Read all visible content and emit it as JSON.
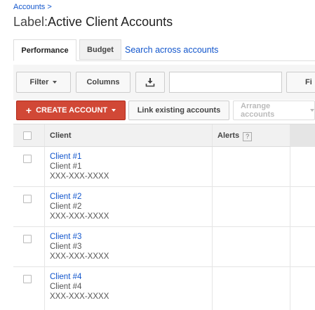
{
  "breadcrumb": {
    "link": "Accounts",
    "separator": ">"
  },
  "title": {
    "prefix": "Label:",
    "text": "Active Client Accounts"
  },
  "tabs": [
    {
      "label": "Performance"
    },
    {
      "label": "Budget"
    }
  ],
  "search_link": "Search across accounts",
  "toolbar": {
    "filter_label": "Filter",
    "columns_label": "Columns",
    "find_label": "Fi",
    "search_value": ""
  },
  "actions": {
    "create_label": "CREATE ACCOUNT",
    "create_icon": "+",
    "link_label": "Link existing accounts",
    "arrange_label": "Arrange accounts"
  },
  "table": {
    "headers": {
      "client": "Client",
      "alerts": "Alerts",
      "alerts_help": "?"
    },
    "rows": [
      {
        "name": "Client #1",
        "sub": "Client #1",
        "id": "XXX-XXX-XXXX"
      },
      {
        "name": "Client #2",
        "sub": "Client #2",
        "id": "XXX-XXX-XXXX"
      },
      {
        "name": "Client #3",
        "sub": "Client #3",
        "id": "XXX-XXX-XXXX"
      },
      {
        "name": "Client #4",
        "sub": "Client #4",
        "id": "XXX-XXX-XXXX"
      }
    ]
  },
  "icons": {
    "download": "download-icon"
  },
  "colors": {
    "link": "#1155cc",
    "create_button": "#d14836"
  }
}
